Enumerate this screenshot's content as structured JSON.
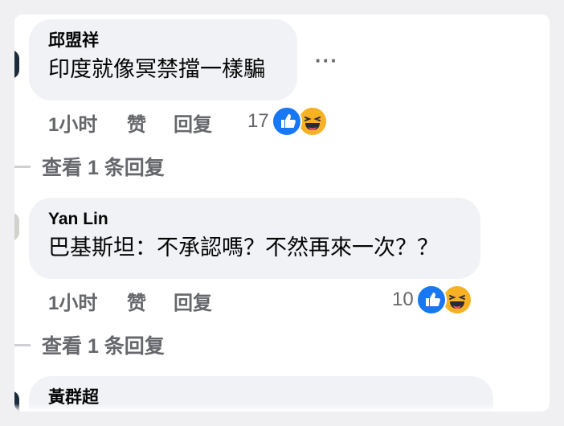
{
  "comments": [
    {
      "author": "邱盟祥",
      "text": "印度就像冥禁擋一樣騙",
      "time": "1小时",
      "like_label": "赞",
      "reply_label": "回复",
      "reaction_count": "17",
      "reactions": [
        "like-icon",
        "haha-icon"
      ],
      "more_label": "···",
      "view_replies": "查看 1 条回复"
    },
    {
      "author": "Yan Lin",
      "text": "巴基斯坦：不承認嗎？不然再來一次？？",
      "time": "1小时",
      "like_label": "赞",
      "reply_label": "回复",
      "reaction_count": "10",
      "reactions": [
        "like-icon",
        "haha-icon"
      ],
      "view_replies": "查看 1 条回复"
    },
    {
      "author": "黃群超"
    }
  ],
  "colors": {
    "bubble": "#f0f2f5",
    "meta_text": "#65676b",
    "like_blue": "#1877f2",
    "haha_yellow": "#f7b125"
  }
}
